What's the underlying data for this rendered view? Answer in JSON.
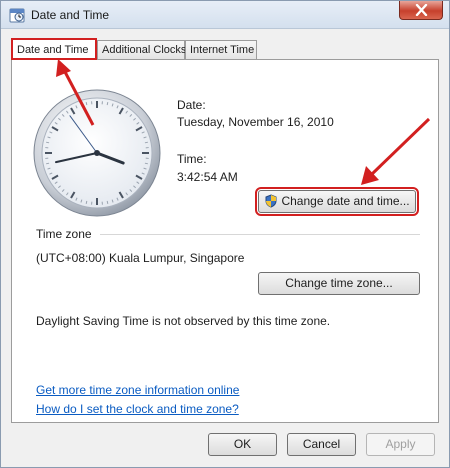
{
  "window": {
    "title": "Date and Time"
  },
  "tabs": [
    {
      "label": "Date and Time"
    },
    {
      "label": "Additional Clocks"
    },
    {
      "label": "Internet Time"
    }
  ],
  "date_section": {
    "date_label": "Date:",
    "date_value": "Tuesday, November 16, 2010",
    "time_label": "Time:",
    "time_value": "3:42:54 AM",
    "change_button": "Change date and time..."
  },
  "timezone_section": {
    "heading": "Time zone",
    "value": "(UTC+08:00) Kuala Lumpur, Singapore",
    "change_button": "Change time zone...",
    "dst_note": "Daylight Saving Time is not observed by this time zone."
  },
  "links": {
    "more_info": "Get more time zone information online",
    "how_to": "How do I set the clock and time zone?"
  },
  "footer": {
    "ok": "OK",
    "cancel": "Cancel",
    "apply": "Apply"
  },
  "clock": {
    "hours": 3,
    "minutes": 42,
    "seconds": 54
  },
  "colors": {
    "annotation": "#d22020",
    "link": "#0b5cc2"
  }
}
